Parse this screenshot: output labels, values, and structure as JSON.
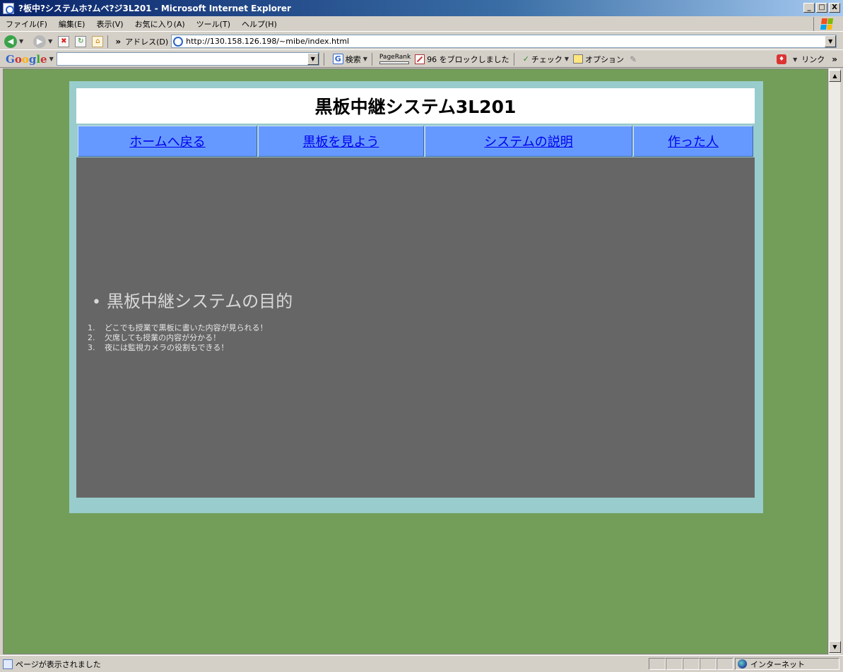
{
  "window": {
    "title": "?板中?システムホ?ムペ?ジ3L201 - Microsoft Internet Explorer",
    "buttons": {
      "minimize": "_",
      "maximize": "□",
      "close": "X"
    }
  },
  "menu": {
    "items": [
      "ファイル(F)",
      "編集(E)",
      "表示(V)",
      "お気に入り(A)",
      "ツール(T)",
      "ヘルプ(H)"
    ]
  },
  "address_bar": {
    "chevron": "»",
    "label": "アドレス(D)",
    "url": "http://130.158.126.198/~mibe/index.html"
  },
  "google_toolbar": {
    "logo": {
      "g1": "G",
      "o1": "o",
      "o2": "o",
      "g2": "g",
      "l": "l",
      "e": "e"
    },
    "search_button": "検索",
    "pagerank_label": "PageRank",
    "blocked": "96 をブロックしました",
    "check": "チェック",
    "options": "オプション",
    "links": "リンク",
    "chevron": "»"
  },
  "page": {
    "heading": "黒板中継システム3L201",
    "nav": [
      {
        "label": "ホームへ戻る"
      },
      {
        "label": "黒板を見よう"
      },
      {
        "label": "システムの説明"
      },
      {
        "label": "作った人"
      }
    ],
    "purpose_title": "黒板中継システムの目的",
    "purpose_items": [
      {
        "num": "1.",
        "text": "どこでも授業で黒板に書いた内容が見られる！"
      },
      {
        "num": "2.",
        "text": "欠席しても授業の内容が分かる！"
      },
      {
        "num": "3.",
        "text": "夜には監視カメラの役割もできる！"
      }
    ]
  },
  "status_bar": {
    "text": "ページが表示されました",
    "zone": "インターネット"
  },
  "colors": {
    "page_background": "#739e59",
    "frame": "#99cccc",
    "content_background": "#666666",
    "nav_cell": "#6699ff",
    "link": "#0000ee"
  }
}
